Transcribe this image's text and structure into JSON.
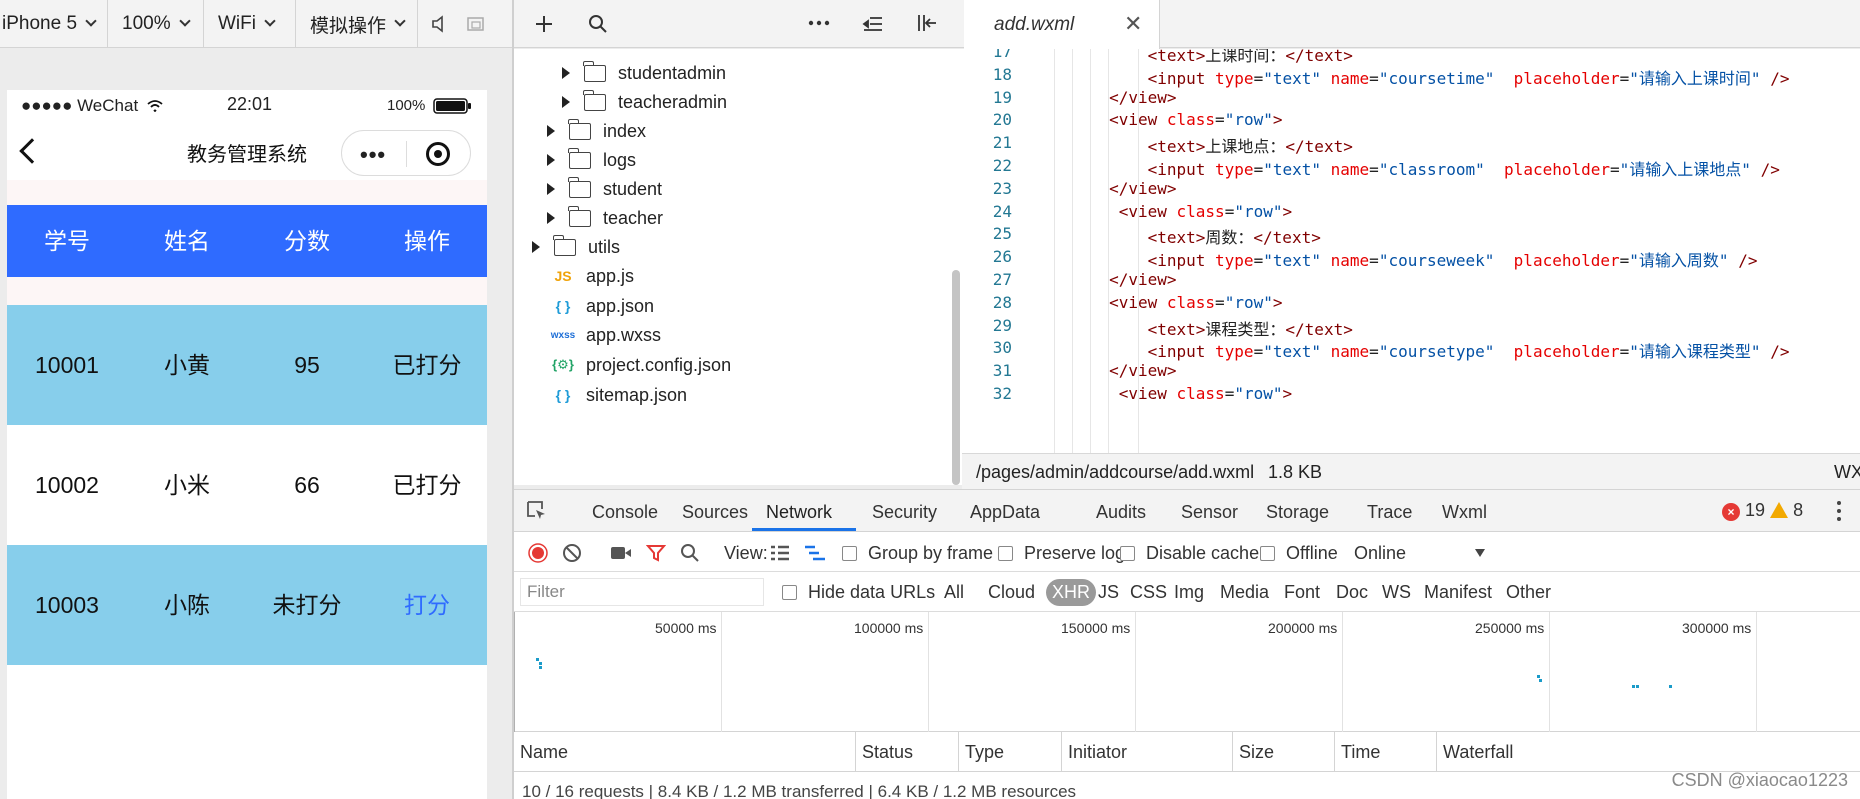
{
  "simulator_bar": {
    "device": "iPhone 5",
    "zoom": "100%",
    "network": "WiFi",
    "mode": "模拟操作"
  },
  "phone": {
    "carrier": "●●●●● WeChat",
    "time": "22:01",
    "battery": "100%",
    "nav_title": "教务管理系统",
    "capsule_more": "•••",
    "table": {
      "headers": [
        "学号",
        "姓名",
        "分数",
        "操作"
      ],
      "rows": [
        {
          "id": "10001",
          "name": "小黄",
          "score": "95",
          "action": "已打分"
        },
        {
          "id": "10002",
          "name": "小米",
          "score": "66",
          "action": "已打分"
        },
        {
          "id": "10003",
          "name": "小陈",
          "score": "未打分",
          "action": "打分"
        }
      ]
    },
    "colors": {
      "header_bg": "#2f6bff",
      "row_bg": "#87ceeb",
      "link": "#2f6bff"
    }
  },
  "file_tree": {
    "items": [
      {
        "label": "studentadmin",
        "kind": "folder"
      },
      {
        "label": "teacheradmin",
        "kind": "folder"
      },
      {
        "label": "index",
        "kind": "folder"
      },
      {
        "label": "logs",
        "kind": "folder"
      },
      {
        "label": "student",
        "kind": "folder"
      },
      {
        "label": "teacher",
        "kind": "folder"
      },
      {
        "label": "utils",
        "kind": "folder"
      },
      {
        "label": "app.js",
        "kind": "js"
      },
      {
        "label": "app.json",
        "kind": "json"
      },
      {
        "label": "app.wxss",
        "kind": "wxss"
      },
      {
        "label": "project.config.json",
        "kind": "config"
      },
      {
        "label": "sitemap.json",
        "kind": "json"
      }
    ],
    "file_icons": {
      "js": "JS",
      "json": "{ }",
      "wxss": "wxss",
      "config": "{⚙}"
    }
  },
  "editor": {
    "tab": {
      "name": "add.wxml",
      "close": "✕"
    },
    "lines": [
      {
        "no": "17",
        "tokens": [
          [
            "p",
            "            "
          ],
          [
            "t",
            "<text>"
          ],
          [
            "p",
            "上课时间："
          ],
          [
            "t",
            "</text>"
          ]
        ]
      },
      {
        "no": "18",
        "tokens": [
          [
            "p",
            "            "
          ],
          [
            "t",
            "<input"
          ],
          [
            "p",
            " "
          ],
          [
            "a",
            "type"
          ],
          [
            "p",
            "="
          ],
          [
            "s",
            "\"text\""
          ],
          [
            "p",
            " "
          ],
          [
            "a",
            "name"
          ],
          [
            "p",
            "="
          ],
          [
            "s",
            "\"coursetime\""
          ],
          [
            "p",
            "  "
          ],
          [
            "a",
            "placeholder"
          ],
          [
            "p",
            "="
          ],
          [
            "s",
            "\"请输入上课时间\""
          ],
          [
            "p",
            " "
          ],
          [
            "t",
            "/>"
          ]
        ]
      },
      {
        "no": "19",
        "tokens": [
          [
            "p",
            "        "
          ],
          [
            "t",
            "</view>"
          ]
        ]
      },
      {
        "no": "20",
        "tokens": [
          [
            "p",
            "        "
          ],
          [
            "t",
            "<view"
          ],
          [
            "p",
            " "
          ],
          [
            "a",
            "class"
          ],
          [
            "p",
            "="
          ],
          [
            "s",
            "\"row\""
          ],
          [
            "t",
            ">"
          ]
        ]
      },
      {
        "no": "21",
        "tokens": [
          [
            "p",
            "            "
          ],
          [
            "t",
            "<text>"
          ],
          [
            "p",
            "上课地点："
          ],
          [
            "t",
            "</text>"
          ]
        ]
      },
      {
        "no": "22",
        "tokens": [
          [
            "p",
            "            "
          ],
          [
            "t",
            "<input"
          ],
          [
            "p",
            " "
          ],
          [
            "a",
            "type"
          ],
          [
            "p",
            "="
          ],
          [
            "s",
            "\"text\""
          ],
          [
            "p",
            " "
          ],
          [
            "a",
            "name"
          ],
          [
            "p",
            "="
          ],
          [
            "s",
            "\"classroom\""
          ],
          [
            "p",
            "  "
          ],
          [
            "a",
            "placeholder"
          ],
          [
            "p",
            "="
          ],
          [
            "s",
            "\"请输入上课地点\""
          ],
          [
            "p",
            " "
          ],
          [
            "t",
            "/>"
          ]
        ]
      },
      {
        "no": "23",
        "tokens": [
          [
            "p",
            "        "
          ],
          [
            "t",
            "</view>"
          ]
        ]
      },
      {
        "no": "24",
        "tokens": [
          [
            "p",
            "         "
          ],
          [
            "t",
            "<view"
          ],
          [
            "p",
            " "
          ],
          [
            "a",
            "class"
          ],
          [
            "p",
            "="
          ],
          [
            "s",
            "\"row\""
          ],
          [
            "t",
            ">"
          ]
        ]
      },
      {
        "no": "25",
        "tokens": [
          [
            "p",
            "            "
          ],
          [
            "t",
            "<text>"
          ],
          [
            "p",
            "周数："
          ],
          [
            "t",
            "</text>"
          ]
        ]
      },
      {
        "no": "26",
        "tokens": [
          [
            "p",
            "            "
          ],
          [
            "t",
            "<input"
          ],
          [
            "p",
            " "
          ],
          [
            "a",
            "type"
          ],
          [
            "p",
            "="
          ],
          [
            "s",
            "\"text\""
          ],
          [
            "p",
            " "
          ],
          [
            "a",
            "name"
          ],
          [
            "p",
            "="
          ],
          [
            "s",
            "\"courseweek\""
          ],
          [
            "p",
            "  "
          ],
          [
            "a",
            "placeholder"
          ],
          [
            "p",
            "="
          ],
          [
            "s",
            "\"请输入周数\""
          ],
          [
            "p",
            " "
          ],
          [
            "t",
            "/>"
          ]
        ]
      },
      {
        "no": "27",
        "tokens": [
          [
            "p",
            "        "
          ],
          [
            "t",
            "</view>"
          ]
        ]
      },
      {
        "no": "28",
        "tokens": [
          [
            "p",
            "        "
          ],
          [
            "t",
            "<view"
          ],
          [
            "p",
            " "
          ],
          [
            "a",
            "class"
          ],
          [
            "p",
            "="
          ],
          [
            "s",
            "\"row\""
          ],
          [
            "t",
            ">"
          ]
        ]
      },
      {
        "no": "29",
        "tokens": [
          [
            "p",
            "            "
          ],
          [
            "t",
            "<text>"
          ],
          [
            "p",
            "课程类型："
          ],
          [
            "t",
            "</text>"
          ]
        ]
      },
      {
        "no": "30",
        "tokens": [
          [
            "p",
            "            "
          ],
          [
            "t",
            "<input"
          ],
          [
            "p",
            " "
          ],
          [
            "a",
            "type"
          ],
          [
            "p",
            "="
          ],
          [
            "s",
            "\"text\""
          ],
          [
            "p",
            " "
          ],
          [
            "a",
            "name"
          ],
          [
            "p",
            "="
          ],
          [
            "s",
            "\"coursetype\""
          ],
          [
            "p",
            "  "
          ],
          [
            "a",
            "placeholder"
          ],
          [
            "p",
            "="
          ],
          [
            "s",
            "\"请输入课程类型\""
          ],
          [
            "p",
            " "
          ],
          [
            "t",
            "/>"
          ]
        ]
      },
      {
        "no": "31",
        "tokens": [
          [
            "p",
            "        "
          ],
          [
            "t",
            "</view>"
          ]
        ]
      },
      {
        "no": "32",
        "tokens": [
          [
            "p",
            "         "
          ],
          [
            "t",
            "<view"
          ],
          [
            "p",
            " "
          ],
          [
            "a",
            "class"
          ],
          [
            "p",
            "="
          ],
          [
            "s",
            "\"row\""
          ],
          [
            "t",
            ">"
          ]
        ]
      }
    ],
    "status_path": "/pages/admin/addcourse/add.wxml",
    "status_size": "1.8 KB",
    "status_lang": "WX"
  },
  "devtools": {
    "tabs": [
      "Console",
      "Sources",
      "Network",
      "Security",
      "AppData",
      "Audits",
      "Sensor",
      "Storage",
      "Trace",
      "Wxml"
    ],
    "active_tab": "Network",
    "error_count": "19",
    "warning_count": "8",
    "toolbar": {
      "view_label": "View:",
      "group_by_frame": "Group by frame",
      "preserve_log": "Preserve log",
      "disable_cache": "Disable cache",
      "offline": "Offline",
      "throttle": "Online"
    },
    "filter": {
      "placeholder": "Filter",
      "hide_data_urls": "Hide data URLs",
      "types": [
        "All",
        "Cloud",
        "XHR",
        "JS",
        "CSS",
        "Img",
        "Media",
        "Font",
        "Doc",
        "WS",
        "Manifest",
        "Other"
      ],
      "active_type": "XHR"
    },
    "timeline_ticks": [
      "50000 ms",
      "100000 ms",
      "150000 ms",
      "200000 ms",
      "250000 ms",
      "300000 ms"
    ],
    "columns": [
      "Name",
      "Status",
      "Type",
      "Initiator",
      "Size",
      "Time",
      "Waterfall"
    ],
    "summary": "10 / 16 requests | 8.4 KB / 1.2 MB transferred | 6.4 KB / 1.2 MB resources"
  },
  "watermark": "CSDN @xiaocao1223"
}
